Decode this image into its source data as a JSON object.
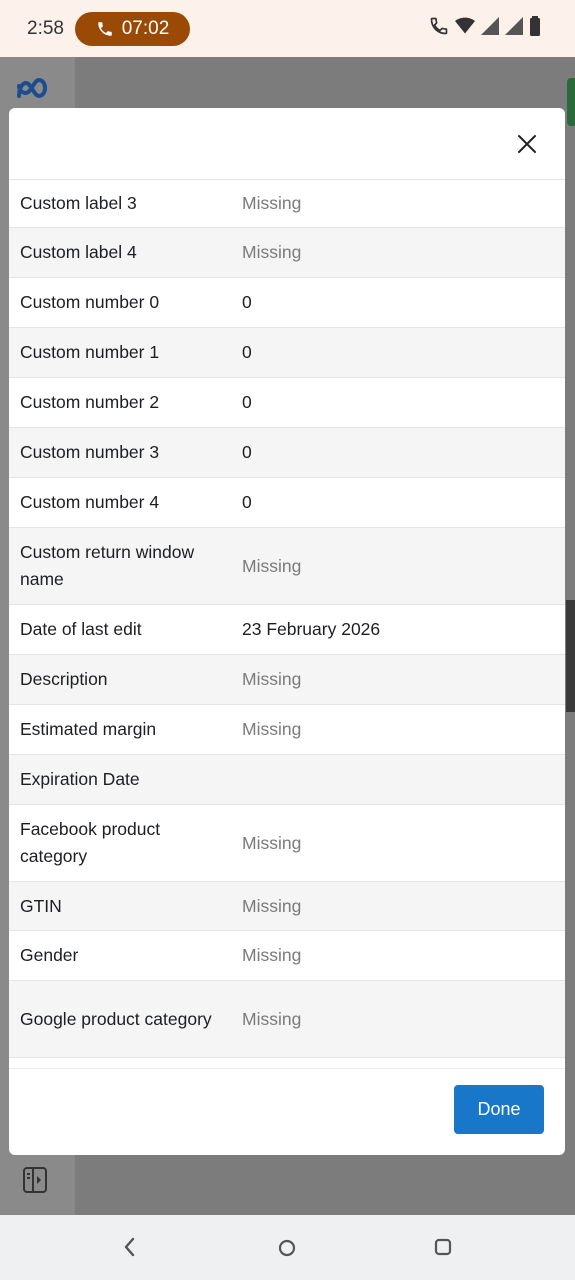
{
  "status_bar": {
    "time": "2:58",
    "call_timer": "07:02"
  },
  "modal": {
    "rows": [
      {
        "label": "Custom label 3",
        "value": "Missing",
        "missing": true
      },
      {
        "label": "Custom label 4",
        "value": "Missing",
        "missing": true
      },
      {
        "label": "Custom number 0",
        "value": "0",
        "missing": false
      },
      {
        "label": "Custom number 1",
        "value": "0",
        "missing": false
      },
      {
        "label": "Custom number 2",
        "value": "0",
        "missing": false
      },
      {
        "label": "Custom number 3",
        "value": "0",
        "missing": false
      },
      {
        "label": "Custom number 4",
        "value": "0",
        "missing": false
      },
      {
        "label": "Custom return window name",
        "value": "Missing",
        "missing": true
      },
      {
        "label": "Date of last edit",
        "value": "23 February 2026",
        "missing": false
      },
      {
        "label": "Description",
        "value": "Missing",
        "missing": true
      },
      {
        "label": "Estimated margin",
        "value": "Missing",
        "missing": true
      },
      {
        "label": "Expiration Date",
        "value": "",
        "missing": false
      },
      {
        "label": "Facebook product category",
        "value": "Missing",
        "missing": true
      },
      {
        "label": "GTIN",
        "value": "Missing",
        "missing": true
      },
      {
        "label": "Gender",
        "value": "Missing",
        "missing": true
      },
      {
        "label": "Google product category",
        "value": "Missing",
        "missing": true
      }
    ],
    "done_label": "Done"
  },
  "colors": {
    "primary_button": "#1877c9",
    "missing_text": "#7b7b7b",
    "call_pill": "#9a4a05"
  },
  "icons": {
    "meta_logo": "meta-logo-icon",
    "close": "close-icon",
    "nav_back": "back-icon",
    "nav_home": "home-icon",
    "nav_recent": "recent-apps-icon"
  }
}
